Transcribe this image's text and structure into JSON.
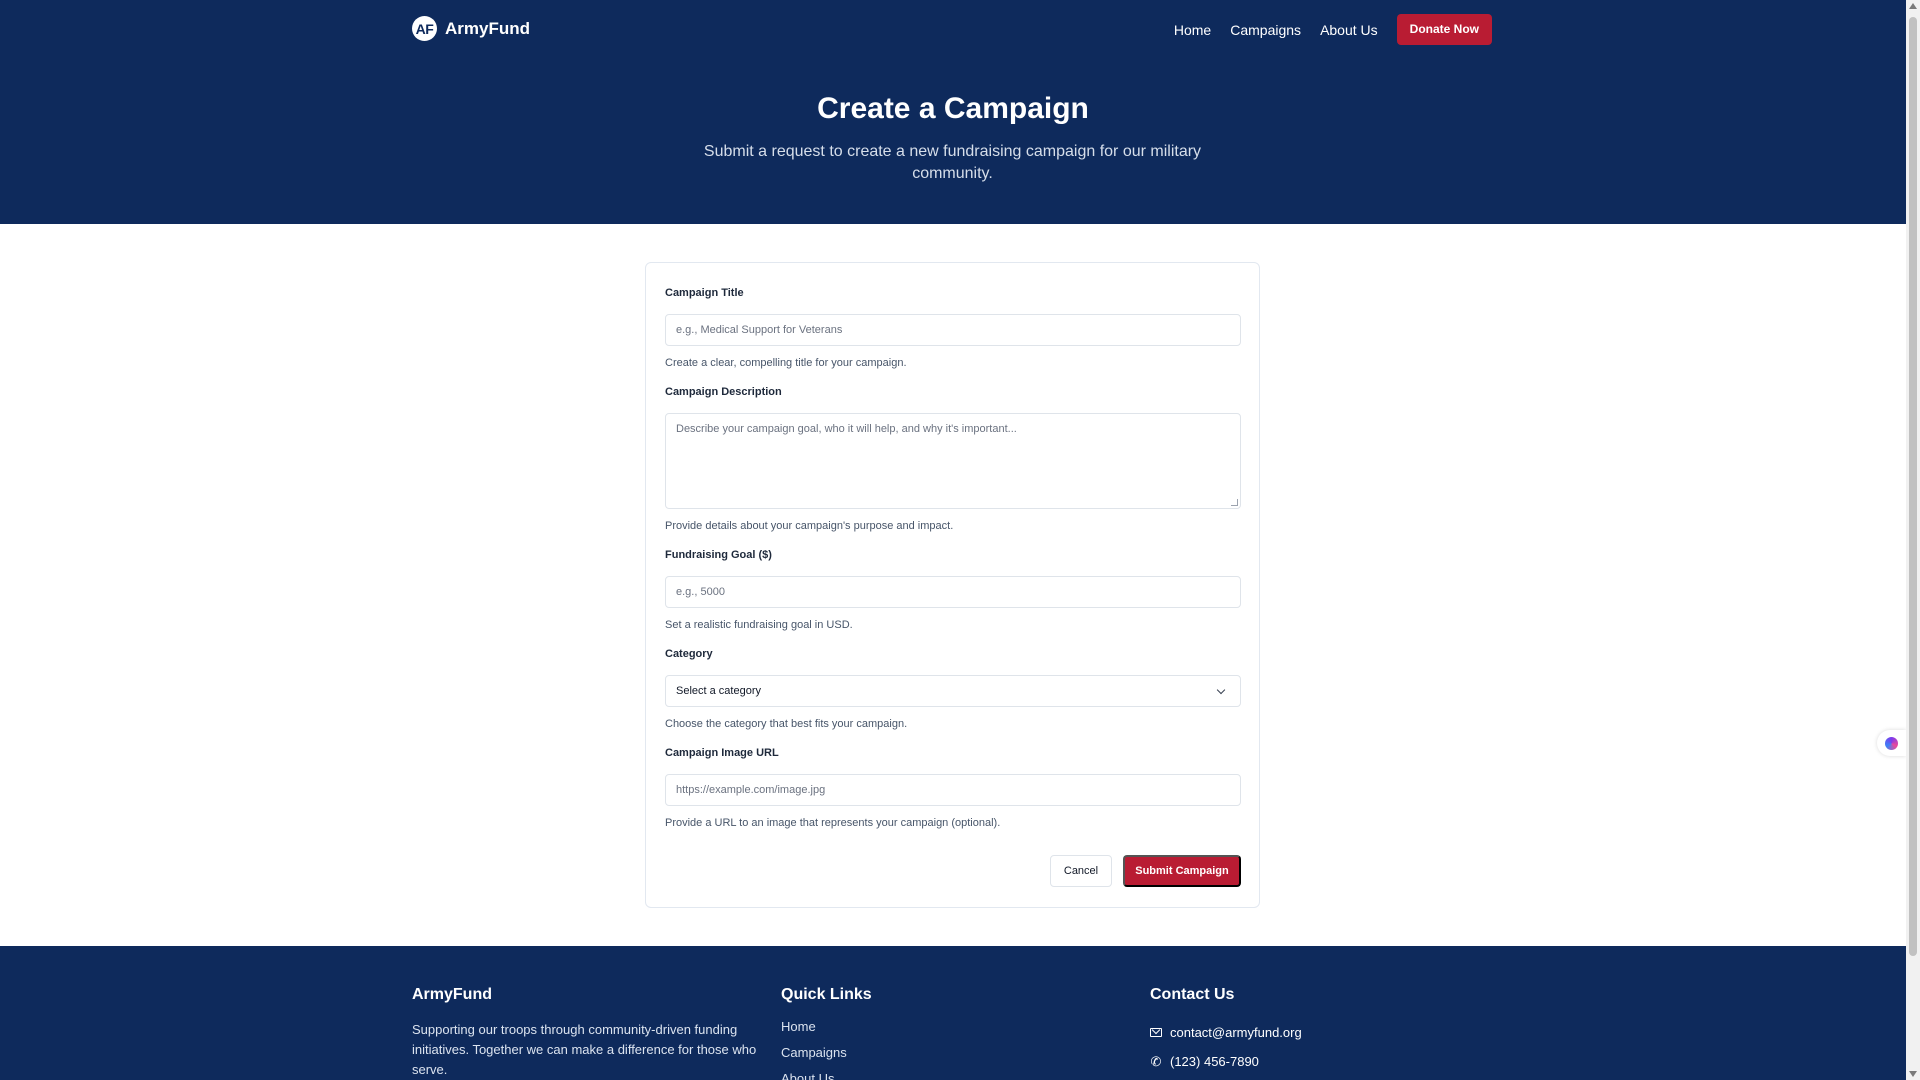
{
  "header": {
    "logo_initials": "AF",
    "brand": "ArmyFund",
    "nav": [
      "Home",
      "Campaigns",
      "About Us"
    ],
    "donate_label": "Donate Now"
  },
  "hero": {
    "title": "Create a Campaign",
    "subtitle": "Submit a request to create a new fundraising campaign for our military community."
  },
  "form": {
    "title": {
      "label": "Campaign Title",
      "placeholder": "e.g., Medical Support for Veterans",
      "help": "Create a clear, compelling title for your campaign."
    },
    "description": {
      "label": "Campaign Description",
      "placeholder": "Describe your campaign goal, who it will help, and why it's important...",
      "help": "Provide details about your campaign's purpose and impact."
    },
    "goal": {
      "label": "Fundraising Goal ($)",
      "placeholder": "e.g., 5000",
      "help": "Set a realistic fundraising goal in USD."
    },
    "category": {
      "label": "Category",
      "selected": "Select a category",
      "help": "Choose the category that best fits your campaign."
    },
    "image": {
      "label": "Campaign Image URL",
      "placeholder": "https://example.com/image.jpg",
      "help": "Provide a URL to an image that represents your campaign (optional)."
    },
    "cancel_label": "Cancel",
    "submit_label": "Submit Campaign"
  },
  "footer": {
    "about": {
      "heading": "ArmyFund",
      "text": "Supporting our troops through community-driven funding initiatives. Together we can make a difference for those who serve."
    },
    "quick_links": {
      "heading": "Quick Links",
      "items": [
        "Home",
        "Campaigns",
        "About Us"
      ]
    },
    "contact": {
      "heading": "Contact Us",
      "email": "contact@armyfund.org",
      "phone": "(123) 456-7890"
    }
  },
  "colors": {
    "navy": "#0e2a5c",
    "accent": "#b91c33"
  },
  "icons": [
    "mail-icon",
    "phone-icon",
    "chevron-down-icon"
  ]
}
